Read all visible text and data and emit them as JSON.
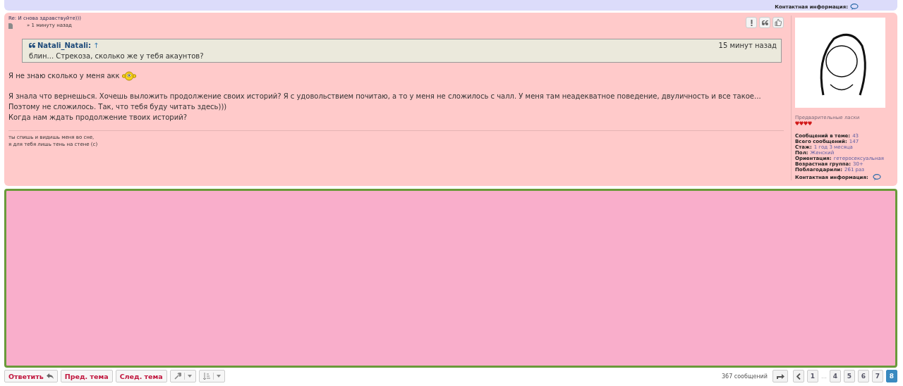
{
  "previous_post": {
    "contact_label": "Контактная информация:"
  },
  "post": {
    "title": "Re: И снова здравствуйте)))",
    "time": "» 1 минуту назад",
    "quote": {
      "author": "Natali_Natali:",
      "link": "↑",
      "time": "15 минут назад",
      "text": "блин... Стрекоза, сколько же у тебя акаунтов?"
    },
    "paragraphs": [
      "Я не знаю сколько у меня акк",
      "Я знала что вернешься. Хочешь выложить продолжение своих историй? Я с удовольствием почитаю, а то у меня не сложилось с чалл. У меня там неадекватное поведение, двуличность и все такое... Поэтому не сложилось. Так, что тебя буду читать здесь)))\nКогда нам ждать продолжение твоих историй?"
    ],
    "signature": [
      "ты спишь и видишь меня во сне,",
      "я для тебя лишь тень на стене (с)"
    ],
    "profile": {
      "rank": "Предварительные ласки",
      "stars": 4,
      "stats": [
        {
          "label": "Сообщений в теме:",
          "value": "43"
        },
        {
          "label": "Всего сообщений:",
          "value": "147"
        },
        {
          "label": "Стаж:",
          "value": "1 год 3 месяца"
        },
        {
          "label": "Пол:",
          "value": "Женский"
        },
        {
          "label": "Ориентация:",
          "value": "гетеросексуальная"
        },
        {
          "label": "Возрастная группа:",
          "value": "30+"
        },
        {
          "label": "Поблагодарили:",
          "value": "261 раз"
        }
      ],
      "contact_label": "Контактная информация:"
    }
  },
  "toolbar": {
    "buttons": [
      "Ответить",
      "Пред. тема",
      "След. тема"
    ],
    "post_count": "367 сообщений",
    "page_gap": "…",
    "pages": [
      {
        "label": "1",
        "selected": false
      },
      {
        "label": "4",
        "selected": false
      },
      {
        "label": "5",
        "selected": false
      },
      {
        "label": "6",
        "selected": false
      },
      {
        "label": "7",
        "selected": false
      },
      {
        "label": "8",
        "selected": true
      }
    ]
  }
}
